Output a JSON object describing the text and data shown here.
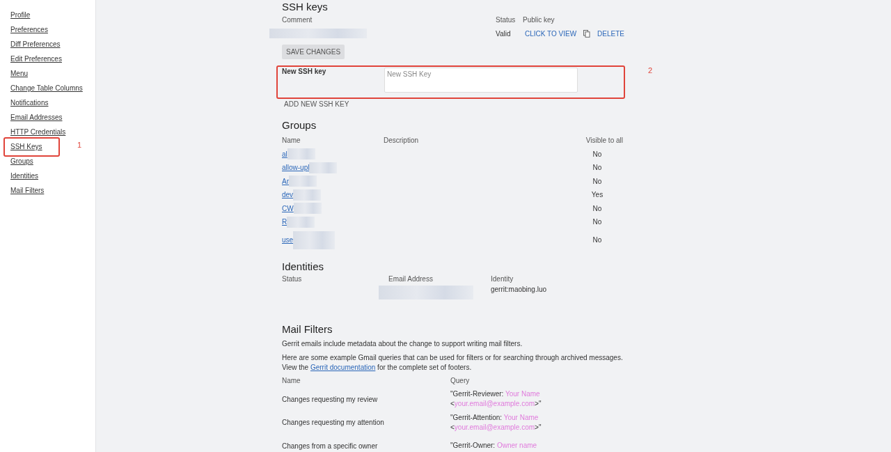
{
  "sidebar": {
    "items": [
      {
        "label": "Profile",
        "selected": false
      },
      {
        "label": "Preferences",
        "selected": false
      },
      {
        "label": "Diff Preferences",
        "selected": false
      },
      {
        "label": "Edit Preferences",
        "selected": false
      },
      {
        "label": "Menu",
        "selected": false
      },
      {
        "label": "Change Table Columns",
        "selected": false
      },
      {
        "label": "Notifications",
        "selected": false
      },
      {
        "label": "Email Addresses",
        "selected": false
      },
      {
        "label": "HTTP Credentials",
        "selected": false
      },
      {
        "label": "SSH Keys",
        "selected": false,
        "callout": "1"
      },
      {
        "label": "Groups",
        "selected": false
      },
      {
        "label": "Identities",
        "selected": false
      },
      {
        "label": "Mail Filters",
        "selected": false
      }
    ]
  },
  "ssh_keys": {
    "title": "SSH keys",
    "columns": [
      "Comment",
      "Status",
      "Public key"
    ],
    "keys": [
      {
        "comment_redacted": true,
        "status": "Valid",
        "view_link": "CLICK TO VIEW",
        "delete_link": "DELETE"
      }
    ],
    "save_button": {
      "label": "SAVE CHANGES",
      "disabled": true
    },
    "new_key": {
      "label": "New SSH key",
      "placeholder": "New SSH Key",
      "callout": "2"
    },
    "add_button": {
      "label": "ADD NEW SSH KEY",
      "disabled": true
    }
  },
  "groups": {
    "title": "Groups",
    "columns": [
      "Name",
      "Description",
      "Visible to all"
    ],
    "rows": [
      {
        "name": "al",
        "redacted": true,
        "visible": "No"
      },
      {
        "name": "allow-upl",
        "redacted": true,
        "visible": "No"
      },
      {
        "name": "Ar",
        "redacted": true,
        "visible": "No"
      },
      {
        "name": "dev",
        "redacted": true,
        "visible": "Yes"
      },
      {
        "name": "CW",
        "redacted": true,
        "visible": "No"
      },
      {
        "name": "R",
        "redacted": true,
        "visible": "No"
      },
      {
        "name": "use",
        "redacted": true,
        "visible": "No",
        "tall": true
      }
    ]
  },
  "identities": {
    "title": "Identities",
    "columns": [
      "Status",
      "Email Address",
      "Identity"
    ],
    "rows": [
      {
        "email_redacted": true,
        "identity": "gerrit:maobing.luo"
      }
    ]
  },
  "mail_filters": {
    "title": "Mail Filters",
    "intro": "Gerrit emails include metadata about the change to support writing mail filters.",
    "examples_text": "Here are some example Gmail queries that can be used for filters or for searching through archived messages.",
    "view_before": "View the",
    "doc_link": "Gerrit documentation",
    "view_after": "for the complete set of footers.",
    "columns": [
      "Name",
      "Query"
    ],
    "rows": [
      {
        "name": "Changes requesting my review",
        "query": [
          {
            "kind": "plain",
            "text": "\"Gerrit-Reviewer: "
          },
          {
            "kind": "hint",
            "text": "Your Name"
          },
          {
            "kind": "plain",
            "text": " <"
          },
          {
            "kind": "hint",
            "text": "your.email@example.com"
          },
          {
            "kind": "plain",
            "text": ">\""
          }
        ]
      },
      {
        "name": "Changes requesting my attention",
        "query": [
          {
            "kind": "plain",
            "text": "\"Gerrit-Attention: "
          },
          {
            "kind": "hint",
            "text": "Your Name"
          },
          {
            "kind": "plain",
            "text": " <"
          },
          {
            "kind": "hint",
            "text": "your.email@example.com"
          },
          {
            "kind": "plain",
            "text": ">\""
          }
        ]
      },
      {
        "name": "Changes from a specific owner",
        "query": [
          {
            "kind": "plain",
            "text": "\"Gerrit-Owner: "
          },
          {
            "kind": "hint",
            "text": "Owner name"
          }
        ]
      }
    ]
  }
}
